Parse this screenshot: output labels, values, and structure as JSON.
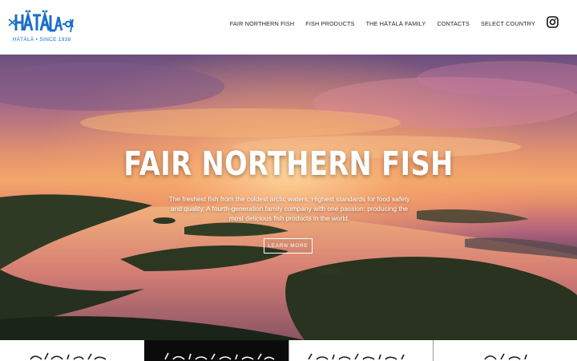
{
  "brand": {
    "tagline": "HÄTÄLÄ • SINCE 1938",
    "logo_color": "#1a6fc7"
  },
  "nav": {
    "items": [
      {
        "label": "FAIR NORTHERN FISH"
      },
      {
        "label": "FISH PRODUCTS"
      },
      {
        "label": "THE HÄTÄLÄ FAMILY"
      },
      {
        "label": "CONTACTS"
      },
      {
        "label": "SELECT COUNTRY"
      }
    ],
    "instagram_icon": "instagram-icon"
  },
  "hero": {
    "title": "FAIR NORTHERN FISH",
    "text": "The freshest fish from the coldest arctic waters. Highest standards for food safety and quality. A fourth-generation family company with one passion: producing the most delicious fish products in the world.",
    "button_label": "LEARN MORE"
  },
  "tiles": [
    {
      "bg": "white"
    },
    {
      "bg": "black"
    },
    {
      "bg": "white"
    },
    {
      "bg": "white"
    }
  ]
}
